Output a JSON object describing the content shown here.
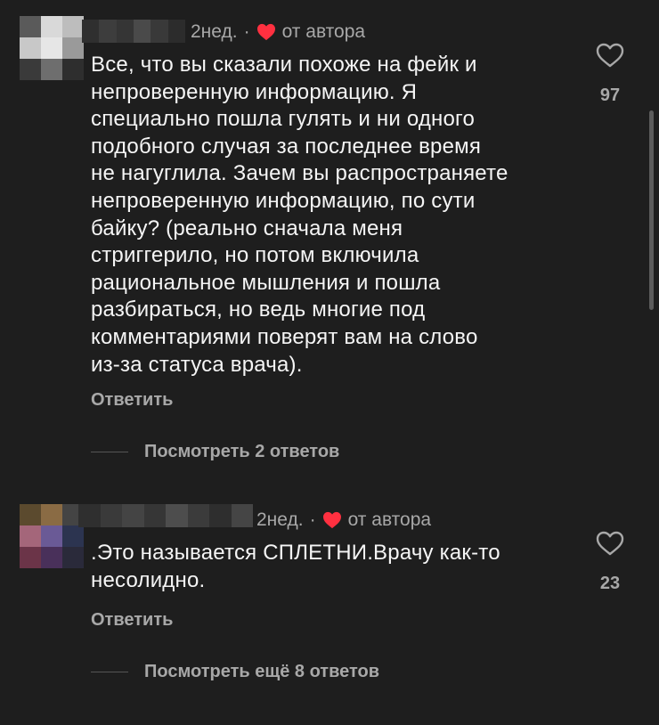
{
  "comments": [
    {
      "time": "2нед.",
      "separator": "·",
      "author_like": "от автора",
      "text": "Все, что вы сказали похоже на фейк и\nнепроверенную информацию. Я\nспециально пошла гулять и ни одного\nподобного случая за последнее время\nне нагуглила. Зачем вы распространяете\nнепроверенную информацию, по сути\nбайку? (реально сначала меня\nстриггерило, но потом включила\nрациональное мышления и пошла\nразбираться, но ведь многие под\nкомментариями поверят вам на слово\nиз-за статуса врача).",
      "reply_label": "Ответить",
      "view_replies": "Посмотреть 2 ответов",
      "likes": "97"
    },
    {
      "time": "2нед.",
      "separator": "·",
      "author_like": "от автора",
      "text": ".Это называется СПЛЕТНИ.Врачу как-то\nнесолидно.",
      "reply_label": "Ответить",
      "view_replies": "Посмотреть ещё 8 ответов",
      "likes": "23"
    }
  ],
  "colors": {
    "background": "#1e1e1e",
    "text": "#f5f5f5",
    "secondary": "#a8a8a8",
    "author_heart": "#ff3040"
  }
}
